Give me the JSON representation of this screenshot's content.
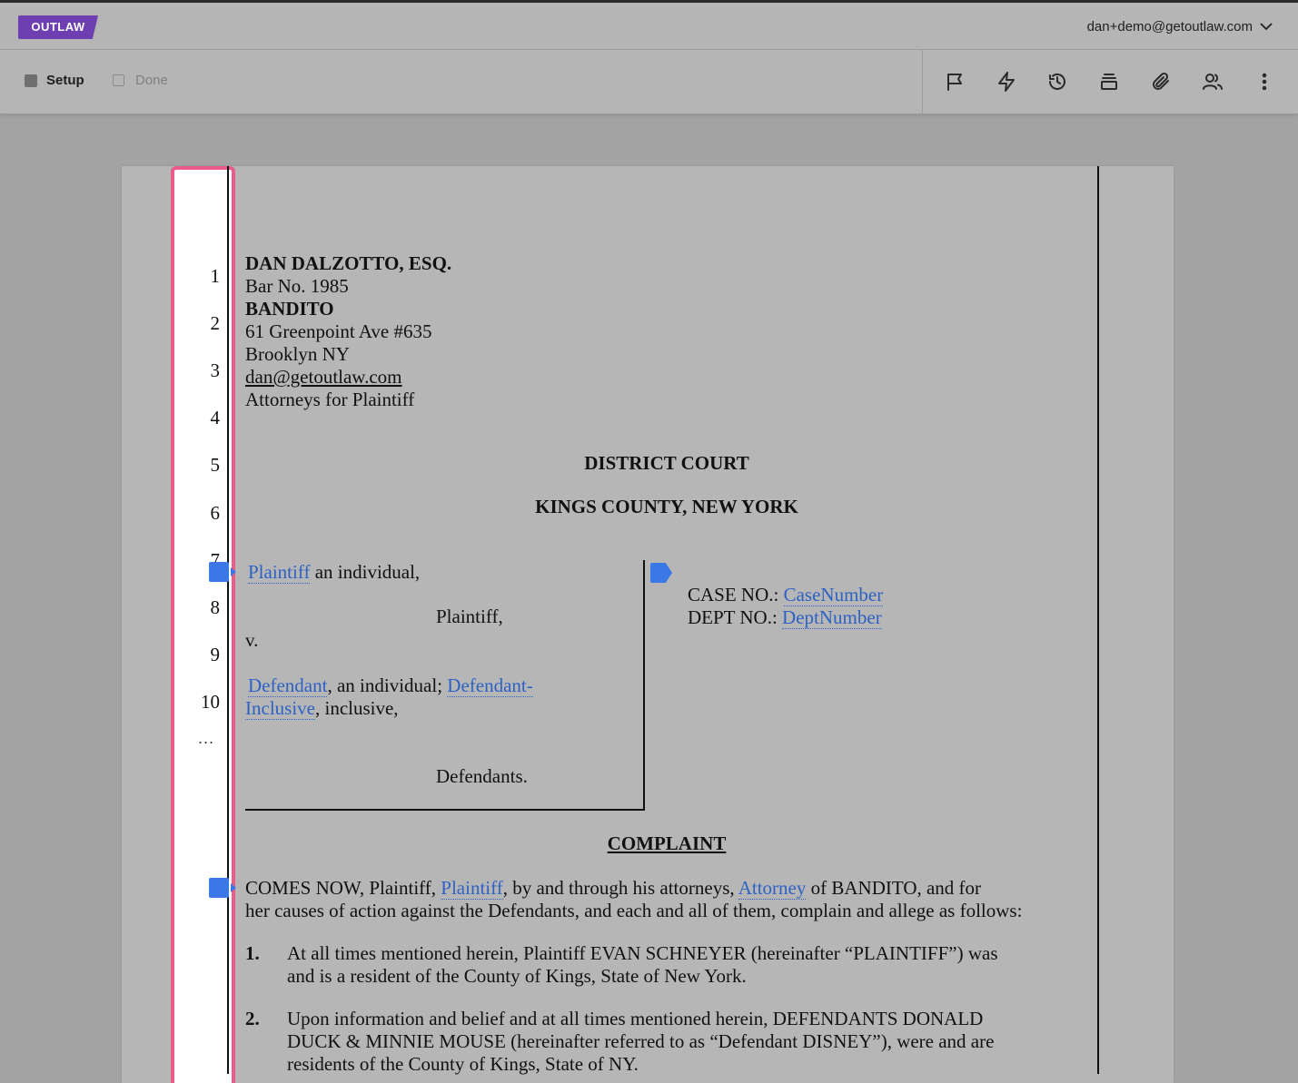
{
  "header": {
    "logo": "OUTLAW",
    "account_email": "dan+demo@getoutlaw.com"
  },
  "toolbar": {
    "steps": [
      {
        "label": "Setup",
        "state": "active"
      },
      {
        "label": "Done",
        "state": "inactive"
      }
    ],
    "tools": [
      "flag-icon",
      "lightning-icon",
      "history-icon",
      "layers-icon",
      "attachment-icon",
      "users-icon",
      "more-vertical-icon"
    ]
  },
  "gutter": {
    "line_numbers": [
      "1",
      "2",
      "3",
      "4",
      "5",
      "6",
      "7",
      "8",
      "9",
      "10"
    ],
    "more": "..."
  },
  "document": {
    "attorney": {
      "name": "DAN DALZOTTO, ESQ.",
      "bar": "Bar No. 1985",
      "firm": "BANDITO",
      "address": "61 Greenpoint Ave #635",
      "city": "Brooklyn NY",
      "email": "dan@getoutlaw.com",
      "role": "Attorneys for Plaintiff"
    },
    "court": {
      "line1": "DISTRICT COURT",
      "line2": "KINGS COUNTY, NEW YORK"
    },
    "caption": {
      "plaintiff_var": "Plaintiff",
      "plaintiff_desc": " an individual,",
      "plaintiff_label": "Plaintiff,",
      "versus": "v.",
      "defendant_var": "Defendant",
      "defendant_desc": ", an individual; ",
      "defendant_inclusive_var_1": "Defendant-",
      "defendant_inclusive_var_2": "Inclusive",
      "inclusive_desc": ", inclusive,",
      "defendants_label": "Defendants.",
      "case_no_label": "CASE NO.: ",
      "case_no_var": "CaseNumber",
      "dept_no_label": "DEPT NO.: ",
      "dept_no_var": "DeptNumber"
    },
    "title": "COMPLAINT",
    "intro": {
      "part1": "COMES NOW, Plaintiff, ",
      "plaintiff_var": "Plaintiff",
      "part2": ", by and through his attorneys, ",
      "attorney_var": "Attorney",
      "part3": " of BANDITO, and for",
      "line2": "her causes of action against the Defendants, and each and all of them, complain and allege as follows:"
    },
    "paragraphs": [
      {
        "num": "1.",
        "line1": "At all times mentioned herein, Plaintiff EVAN SCHNEYER (hereinafter “PLAINTIFF”) was",
        "line2": "and is a resident of the County of Kings, State of New York."
      },
      {
        "num": "2.",
        "line1": "Upon information and belief and at all times mentioned herein, DEFENDANTS DONALD",
        "line2": "DUCK & MINNIE MOUSE (hereinafter referred to as “Defendant DISNEY”), were and are",
        "line3": "residents of the County of Kings, State of NY."
      }
    ]
  },
  "colors": {
    "brand": "#6d3fb0",
    "gutter_border": "#ea5c87",
    "variable": "#2d62c4",
    "marker": "#3a78e6"
  }
}
